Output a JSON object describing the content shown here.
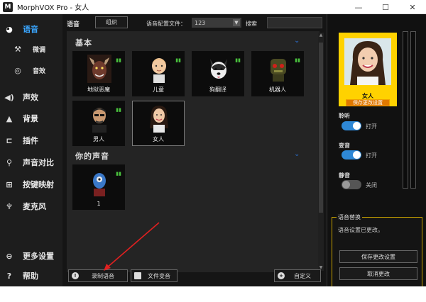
{
  "window": {
    "title": "MorphVOX Pro - 女人",
    "logo": "M",
    "minimize_icon": "—",
    "maximize_icon": "☐",
    "close_icon": "✕"
  },
  "sidebar": {
    "items": [
      {
        "label": "语音",
        "icon": "voice-icon",
        "glyph": "◕"
      },
      {
        "label": "微调",
        "icon": "tools-icon",
        "glyph": "⚒"
      },
      {
        "label": "音效",
        "icon": "lips-icon",
        "glyph": "◎"
      },
      {
        "label": "声效",
        "icon": "speaker-icon",
        "glyph": "◀)"
      },
      {
        "label": "背景",
        "icon": "landscape-icon",
        "glyph": "▲"
      },
      {
        "label": "插件",
        "icon": "plug-icon",
        "glyph": "⊏"
      },
      {
        "label": "声音对比",
        "icon": "magnifier-icon",
        "glyph": "⚲"
      },
      {
        "label": "按键映射",
        "icon": "keyboard-icon",
        "glyph": "⊞"
      },
      {
        "label": "麦克风",
        "icon": "microphone-icon",
        "glyph": "♆"
      },
      {
        "label": "更多设置",
        "icon": "minus-circle-icon",
        "glyph": "⊖"
      },
      {
        "label": "帮助",
        "icon": "help-icon",
        "glyph": "?"
      }
    ]
  },
  "toolbar": {
    "title": "语音",
    "organize_label": "组织",
    "profile_label": "语音配置文件：",
    "profile_value": "123",
    "search_label": "搜索",
    "search_placeholder": ""
  },
  "sections": {
    "basic_title": "基本",
    "yours_title": "你的声音"
  },
  "voices": [
    {
      "name": "地狱恶魔"
    },
    {
      "name": "儿童"
    },
    {
      "name": "狗翻译"
    },
    {
      "name": "机器人"
    },
    {
      "name": "男人"
    },
    {
      "name": "女人"
    }
  ],
  "my_voices": [
    {
      "name": "1"
    }
  ],
  "bottom_buttons": {
    "record_label": "录制语音",
    "file_label": "文件变音",
    "custom_label": "自定义"
  },
  "right_panel": {
    "current_voice_name": "女人",
    "save_changes_small": "保存更改设置",
    "toggles": [
      {
        "label": "聆听",
        "state": "打开",
        "on": true
      },
      {
        "label": "变音",
        "state": "打开",
        "on": true
      },
      {
        "label": "静音",
        "state": "关闭",
        "on": false
      }
    ],
    "changes_box": {
      "title": "语音替换",
      "message": "语音设置已更改。",
      "save_button": "保存更改设置",
      "cancel_button": "取消更改"
    }
  },
  "colors": {
    "accent_blue": "#3aa6ff",
    "toggle_on": "#2e88d6",
    "avatar_frame": "#ffd200",
    "save_orange": "#e07800",
    "signal_green": "#49c23d",
    "annotation_red": "#e02020"
  }
}
